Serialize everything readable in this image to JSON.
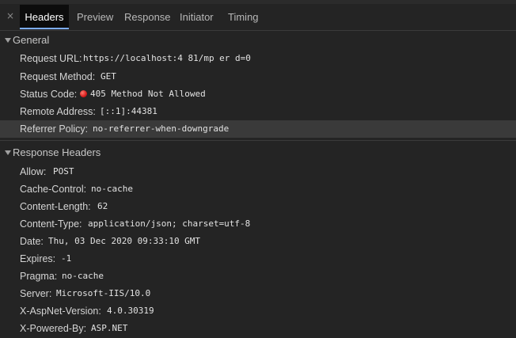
{
  "tabs": {
    "close_glyph": "×",
    "items": [
      "Headers",
      "Preview",
      "Response",
      "Initiator",
      "Timing"
    ]
  },
  "general": {
    "title": "General",
    "request_url": {
      "key": "Request URL:",
      "value": "https://localhost:4  81/mp         er              d=0"
    },
    "request_method": {
      "key": "Request Method:",
      "value": "GET"
    },
    "status_code": {
      "key": "Status Code:",
      "value": "405 Method Not Allowed"
    },
    "remote_address": {
      "key": "Remote Address:",
      "value": "[::1]:44381"
    },
    "referrer_policy": {
      "key": "Referrer Policy:",
      "value": "no-referrer-when-downgrade"
    }
  },
  "response_headers": {
    "title": "Response Headers",
    "items": [
      {
        "key": "Allow:",
        "value": "POST"
      },
      {
        "key": "Cache-Control:",
        "value": "no-cache"
      },
      {
        "key": "Content-Length:",
        "value": "62"
      },
      {
        "key": "Content-Type:",
        "value": "application/json; charset=utf-8"
      },
      {
        "key": "Date:",
        "value": "Thu, 03 Dec 2020 09:33:10 GMT"
      },
      {
        "key": "Expires:",
        "value": "-1"
      },
      {
        "key": "Pragma:",
        "value": "no-cache"
      },
      {
        "key": "Server:",
        "value": "Microsoft-IIS/10.0"
      },
      {
        "key": "X-AspNet-Version:",
        "value": "4.0.30319"
      },
      {
        "key": "X-Powered-By:",
        "value": "ASP.NET"
      }
    ]
  },
  "colors": {
    "background": "#242424",
    "active_tab_bg": "#0c0c0c",
    "active_tab_underline": "#7cacf8",
    "highlight_row": "#3a3a3a",
    "status_error": "#d81d1d"
  }
}
